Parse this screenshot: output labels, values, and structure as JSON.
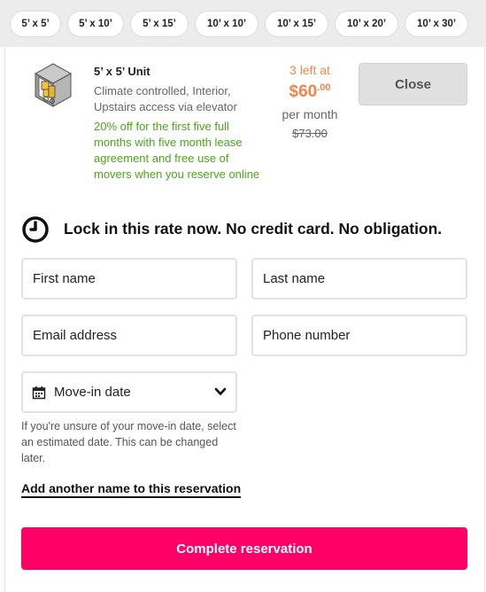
{
  "size_tabs": [
    {
      "label": "5’ x 5’"
    },
    {
      "label": "5’ x 10’"
    },
    {
      "label": "5’ x 15’"
    },
    {
      "label": "10’ x 10’"
    },
    {
      "label": "10’ x 15’"
    },
    {
      "label": "10’ x 20’"
    },
    {
      "label": "10’ x 30’"
    }
  ],
  "unit": {
    "title": "5’ x 5’ Unit",
    "features": "Climate controlled, Interior, Upstairs access via elevator",
    "promo": "20% off for the first five full months with five month lease agreement and free use of movers when you reserve online",
    "image_icon": "storage-unit-isometric-icon"
  },
  "pricing": {
    "left_count": "3 left at",
    "price_dollars": "$60",
    "price_cents": ".00",
    "period": "per month",
    "original_price": "$73.00"
  },
  "close_label": "Close",
  "lock_message": "Lock in this rate now. No credit card. No obligation.",
  "form": {
    "first_name_placeholder": "First name",
    "last_name_placeholder": "Last name",
    "email_placeholder": "Email address",
    "phone_placeholder": "Phone number",
    "move_in_label": "Move-in date",
    "move_in_hint": "If you're unsure of your move-in date, select an estimated date. This can be changed later.",
    "add_name_link": "Add another name to this reservation",
    "submit_label": "Complete reservation"
  },
  "colors": {
    "accent_pink": "#ff0066",
    "price_orange": "#f5844c",
    "promo_green": "#4aa61a"
  }
}
